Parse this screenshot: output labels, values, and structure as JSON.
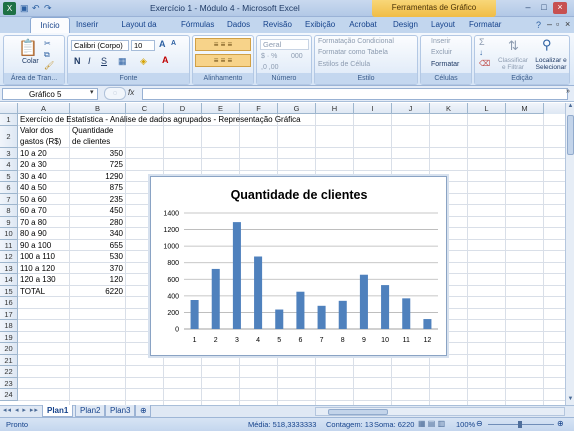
{
  "window": {
    "title": "Exercício 1 - Módulo 4 - Microsoft Excel",
    "context_tab": "Ferramentas de Gráfico"
  },
  "tabs": [
    "Início",
    "Inserir",
    "Layout da Página",
    "Fórmulas",
    "Dados",
    "Revisão",
    "Exibição",
    "Acrobat",
    "Design",
    "Layout",
    "Formatar"
  ],
  "ribbon": {
    "clipboard": {
      "label": "Área de Tran...",
      "paste": "Colar"
    },
    "font": {
      "label": "Fonte",
      "name": "Calibri (Corpo)",
      "size": "10",
      "bold": "N",
      "italic": "I",
      "underline": "S"
    },
    "alignment": {
      "label": "Alinhamento"
    },
    "number": {
      "label": "Número",
      "format": "Geral"
    },
    "style": {
      "label": "Estilo",
      "conditional": "Formatação Condicional",
      "table": "Formatar como Tabela",
      "cell": "Estilos de Célula"
    },
    "cells": {
      "label": "Células",
      "insert": "Inserir",
      "delete": "Excluir",
      "format": "Formatar"
    },
    "editing": {
      "label": "Edição",
      "sort": "Classificar e Filtrar",
      "find": "Localizar e Selecionar"
    }
  },
  "formula": {
    "namebox": "Gráfico 5",
    "fx": "fx",
    "value": ""
  },
  "columns": [
    "A",
    "B",
    "C",
    "D",
    "E",
    "F",
    "G",
    "H",
    "I",
    "J",
    "K",
    "L",
    "M"
  ],
  "rows": [
    "1",
    "2",
    "3",
    "4",
    "5",
    "6",
    "7",
    "8",
    "9",
    "10",
    "11",
    "12",
    "13",
    "14",
    "15",
    "16",
    "17",
    "18",
    "19",
    "20",
    "21",
    "22",
    "23",
    "24"
  ],
  "sheet": {
    "a1": "Exercício de Estatística - Análise de dados agrupados - Representação Gráfica",
    "header_a_l1": "Valor dos",
    "header_a_l2": "gastos (R$)",
    "header_b_l1": "Quantidade",
    "header_b_l2": "de clientes",
    "data": [
      {
        "range": "10 a 20",
        "count": "350"
      },
      {
        "range": "20 a 30",
        "count": "725"
      },
      {
        "range": "30 a 40",
        "count": "1290"
      },
      {
        "range": "40 a 50",
        "count": "875"
      },
      {
        "range": "50 a 60",
        "count": "235"
      },
      {
        "range": "60 a 70",
        "count": "450"
      },
      {
        "range": "70 a 80",
        "count": "280"
      },
      {
        "range": "80 a 90",
        "count": "340"
      },
      {
        "range": "90 a 100",
        "count": "655"
      },
      {
        "range": "100 a 110",
        "count": "530"
      },
      {
        "range": "110 a 120",
        "count": "370"
      },
      {
        "range": "120 a 130",
        "count": "120"
      }
    ],
    "total_label": "TOTAL",
    "total_value": "6220"
  },
  "chart_data": {
    "type": "bar",
    "title": "Quantidade de clientes",
    "categories": [
      "1",
      "2",
      "3",
      "4",
      "5",
      "6",
      "7",
      "8",
      "9",
      "10",
      "11",
      "12"
    ],
    "values": [
      350,
      725,
      1290,
      875,
      235,
      450,
      280,
      340,
      655,
      530,
      370,
      120
    ],
    "ylim": [
      0,
      1400
    ],
    "yticks": [
      0,
      200,
      400,
      600,
      800,
      1000,
      1200,
      1400
    ],
    "grid": true,
    "bar_color": "#4f81bd"
  },
  "sheet_tabs": [
    "Plan1",
    "Plan2",
    "Plan3"
  ],
  "status": {
    "ready": "Pronto",
    "average": "Média: 518,3333333",
    "count": "Contagem: 13",
    "sum": "Soma: 6220",
    "zoom": "100%"
  }
}
